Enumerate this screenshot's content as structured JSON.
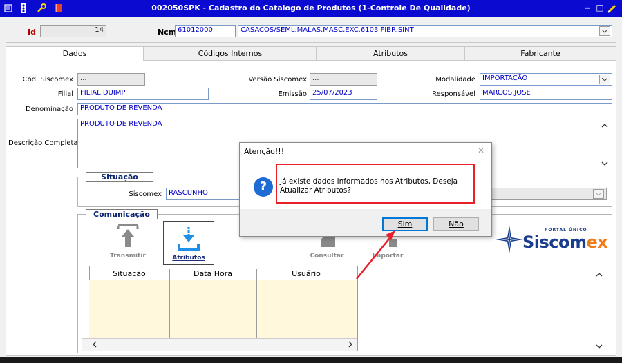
{
  "window": {
    "title": "002050SPK - Cadastro do Catalogo de Produtos (1-Controle De Qualidade)",
    "minimize": "‒",
    "maximize": "□"
  },
  "header": {
    "id_label": "Id",
    "id_value": "14",
    "ncm_label": "Ncm",
    "ncm_value": "61012000",
    "ncm_description": "CASACOS/SEML.MALAS.MASC.EXC.6103 FIBR.SINT"
  },
  "tabs": [
    "Dados",
    "Códigos Internos",
    "Atributos",
    "Fabricante"
  ],
  "form": {
    "cod_siscomex_label": "Cód. Siscomex",
    "cod_siscomex_value": "...",
    "versao_label": "Versão Siscomex",
    "versao_value": "...",
    "modalidade_label": "Modalidade",
    "modalidade_value": "IMPORTAÇÃO",
    "filial_label": "Filial",
    "filial_value": "FILIAL DUIMP",
    "emissao_label": "Emissão",
    "emissao_value": "25/07/2023",
    "responsavel_label": "Responsável",
    "responsavel_value": "MARCOS.JOSE",
    "denominacao_label": "Denominação",
    "denominacao_value": "PRODUTO DE REVENDA",
    "descricao_label": "Descrição Completa",
    "descricao_value": "PRODUTO DE REVENDA"
  },
  "situacao": {
    "title": "Situação",
    "siscomex_label": "Siscomex",
    "siscomex_value": "RASCUNHO"
  },
  "comunicacao": {
    "title": "Comunicação",
    "transmitir": "Transmitir",
    "atributos": "Atributos",
    "consultar": "Consultar",
    "importar": "Importar"
  },
  "grid": {
    "columns": [
      "Situação",
      "Data Hora",
      "Usuário"
    ]
  },
  "logo": {
    "portal": "PORTAL ÚNICO",
    "name_main": "Siscom",
    "name_ex": "ex"
  },
  "dialog": {
    "title": "Atenção!!!",
    "close": "✕",
    "message": "Já existe dados informados nos Atributos, Deseja Atualizar Atributos?",
    "yes": "Sim",
    "no": "Não"
  },
  "colors": {
    "titlebar": "#0a0ad0",
    "field_text": "#0000c8",
    "highlight_red": "#e8202a",
    "logo_blue": "#1a3d8f",
    "logo_orange": "#f07a14"
  }
}
